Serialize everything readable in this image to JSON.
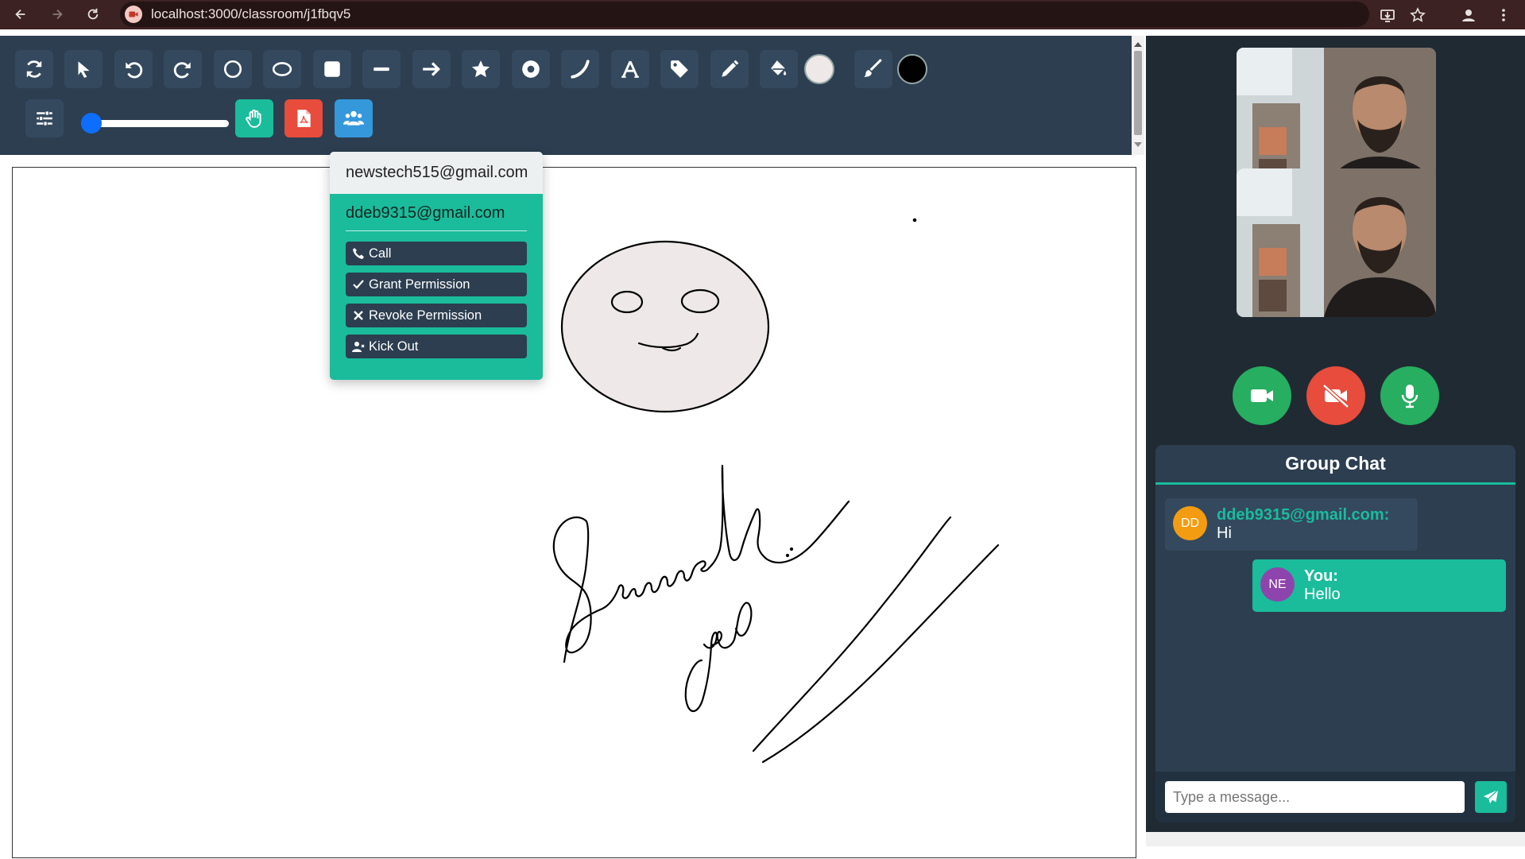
{
  "browser": {
    "url": "localhost:3000/classroom/j1fbqv5",
    "icons": [
      "back-arrow-icon",
      "forward-arrow-icon",
      "reload-icon",
      "site-video-icon",
      "install-app-icon",
      "bookmark-star-icon",
      "profile-icon",
      "kebab-menu-icon"
    ]
  },
  "toolbar": {
    "row1": [
      "refresh-icon",
      "select-pointer-icon",
      "undo-icon",
      "redo-icon",
      "circle-icon",
      "ellipse-icon",
      "rectangle-icon",
      "line-icon",
      "arrow-icon",
      "star-icon",
      "radio-dot-icon",
      "curve-icon",
      "text-a-icon",
      "tag-icon",
      "pencil-icon",
      "fill-bucket-icon",
      "fill-color-swatch",
      "brush-icon",
      "stroke-color-swatch"
    ],
    "row2": [
      "sliders-icon",
      "stroke-width-slider",
      "hand-raise-icon",
      "pdf-file-icon",
      "users-icon"
    ],
    "fill_color": "#eee8e8",
    "stroke_color": "#000000",
    "hand_button_color": "#1abc9c",
    "pdf_button_color": "#e74c3c",
    "users_button_color": "#3498db",
    "stroke_width_fraction": 0.06
  },
  "participants": {
    "own_email": "newstech515@gmail.com",
    "other_email": "ddeb9315@gmail.com",
    "actions": {
      "call": "Call",
      "grant": "Grant Permission",
      "revoke": "Revoke Permission",
      "kick": "Kick Out"
    }
  },
  "video_controls": {
    "camera_color": "#27ae60",
    "stop_camera_color": "#e74c3c",
    "mic_color": "#27ae60"
  },
  "chat": {
    "title": "Group Chat",
    "messages": [
      {
        "initials": "DD",
        "sender": "ddeb9315@gmail.com:",
        "text": "Hi",
        "avatar_color": "#f39c12"
      },
      {
        "initials": "NE",
        "sender": "You:",
        "text": "Hello",
        "avatar_color": "#8e44ad"
      }
    ],
    "input_placeholder": "Type a message..."
  }
}
